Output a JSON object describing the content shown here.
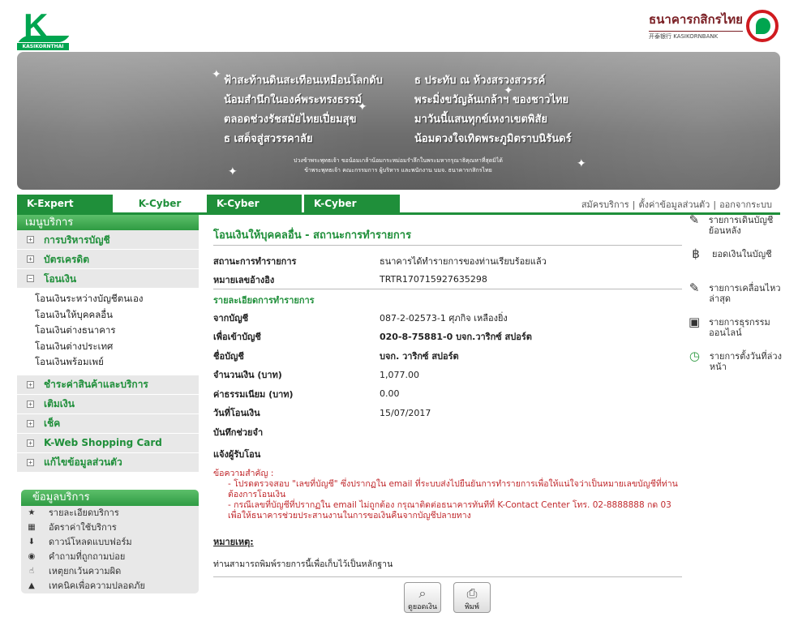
{
  "brand": {
    "logo_text": "KASIKORNTHAI",
    "bank_th": "ธนาคารกสิกรไทย",
    "bank_en": "开泰银行 KASIKORNBANK"
  },
  "banner": {
    "poem_left": [
      "ฟ้าสะท้านดินสะเทือนเหมือนโลกดับ",
      "น้อมสำนึกในองค์พระทรงธรรม์",
      "ตลอดช่วงรัชสมัยไทยเปี่ยมสุข",
      "ธ เสด็จสู่สวรรคาลัย"
    ],
    "poem_right": [
      "ธ ประทับ ณ ห้วงสรวงสวรรค์",
      "พระมิ่งขวัญล้นเกล้าฯ ของชาวไทย",
      "มาวันนี้แสนทุกข์เหงาเขตพิสัย",
      "น้อมดวงใจเทิดพระภูมิตราบนิรันดร์"
    ],
    "dedication": [
      "ปวงข้าพระพุทธเจ้า ขอน้อมเกล้าน้อมกระหม่อมรำลึกในพระมหากรุณาธิคุณหาที่สุดมิได้",
      "ข้าพระพุทธเจ้า คณะกรรมการ ผู้บริหาร และพนักงาน บมจ. ธนาคารกสิกรไทย"
    ]
  },
  "tabs": [
    "K-Expert MyPort",
    "K-Cyber Banking",
    "K-Cyber Invest",
    "K-Cyber Trade"
  ],
  "toplinks": [
    "สมัครบริการ",
    "ตั้งค่าข้อมูลส่วนตัว",
    "ออกจากระบบ"
  ],
  "sidebar": {
    "header": "เมนูบริการ",
    "items": [
      {
        "label": "การบริหารบัญชี",
        "box": "+"
      },
      {
        "label": "บัตรเครดิต",
        "box": "+"
      },
      {
        "label": "โอนเงิน",
        "box": "−"
      }
    ],
    "sub": [
      "โอนเงินระหว่างบัญชีตนเอง",
      "โอนเงินให้บุคคลอื่น",
      "โอนเงินต่างธนาคาร",
      "โอนเงินต่างประเทศ",
      "โอนเงินพร้อมเพย์"
    ],
    "items2": [
      {
        "label": "ชำระค่าสินค้าและบริการ",
        "box": "+"
      },
      {
        "label": "เติมเงิน",
        "box": "+"
      },
      {
        "label": "เช็ค",
        "box": "+"
      },
      {
        "label": "K-Web Shopping Card",
        "box": "+"
      },
      {
        "label": "แก้ไขข้อมูลส่วนตัว",
        "box": "+"
      }
    ]
  },
  "info": {
    "header": "ข้อมูลบริการ",
    "items": [
      {
        "icon": "star-icon",
        "glyph": "★",
        "label": "รายละเอียดบริการ"
      },
      {
        "icon": "calculator-icon",
        "glyph": "▦",
        "label": "อัตราค่าใช้บริการ"
      },
      {
        "icon": "download-icon",
        "glyph": "⬇",
        "label": "ดาวน์โหลดแบบฟอร์ม"
      },
      {
        "icon": "question-icon",
        "glyph": "◉",
        "label": "คำถามที่ถูกถามบ่อย"
      },
      {
        "icon": "hand-icon",
        "glyph": "☝",
        "label": "เหตุยกเว้นความผิด"
      },
      {
        "icon": "lock-icon",
        "glyph": "▲",
        "label": "เทคนิคเพื่อความปลอดภัย"
      }
    ]
  },
  "main": {
    "title": "โอนเงินให้บุคคลอื่น - สถานะการทำรายการ",
    "status_label": "สถานะการทำรายการ",
    "status_value": "ธนาคารได้ทำรายการของท่านเรียบร้อยแล้ว",
    "ref_label": "หมายเลขอ้างอิง",
    "ref_value": "TRTR170715927635298",
    "detail_header": "รายละเอียดการทำรายการ",
    "from_label": "จากบัญชี",
    "from_value": "087-2-02573-1 ศุภกิจ เหลืองยิ่ง",
    "to_label": "เพื่อเข้าบัญชี",
    "to_value": "020-8-75881-0 บจก.วาริกซ์ สปอร์ต",
    "name_label": "ชื่อบัญชี",
    "name_value": "บจก. วาริกซ์ สปอร์ต",
    "amount_label": "จำนวนเงิน (บาท)",
    "amount_value": "1,077.00",
    "fee_label": "ค่าธรรมเนียม (บาท)",
    "fee_value": "0.00",
    "date_label": "วันที่โอนเงิน",
    "date_value": "15/07/2017",
    "memo_label": "บันทึกช่วยจำ",
    "notify_label": "แจ้งผู้รับโอน",
    "warn_head": "ข้อความสำคัญ :",
    "warn1": "- โปรดตรวจสอบ \"เลขที่บัญชี\" ซึ่งปรากฏใน email ที่ระบบส่งไปยืนยันการทำรายการเพื่อให้แน่ใจว่าเป็นหมายเลขบัญชีที่ท่านต้องการโอนเงิน",
    "warn2": "- กรณีเลขที่บัญชีที่ปรากฏใน email ไม่ถูกต้อง กรุณาติดต่อธนาคารทันทีที่ K-Contact Center โทร. 02-8888888 กด 03 เพื่อให้ธนาคารช่วยประสานงานในการขอเงินคืนจากบัญชีปลายทาง",
    "note_head": "หมายเหตุ:",
    "note": "ท่านสามารถพิมพ์รายการนี้เพื่อเก็บไว้เป็นหลักฐาน"
  },
  "buttons": {
    "view": "ดูยอดเงิน",
    "print": "พิมพ์"
  },
  "right": [
    {
      "icon": "statement-icon",
      "glyph": "✎",
      "label": "รายการเดินบัญชีย้อนหลัง"
    },
    {
      "icon": "moneybag-icon",
      "glyph": "฿",
      "label": "ยอดเงินในบัญชี"
    },
    {
      "icon": "recent-icon",
      "glyph": "✎",
      "label": "รายการเคลื่อนไหวล่าสุด"
    },
    {
      "icon": "online-icon",
      "glyph": "▣",
      "label": "รายการธุรกรรมออนไลน์"
    },
    {
      "icon": "clock-icon",
      "glyph": "◷",
      "label": "รายการตั้งวันที่ล่วงหน้า"
    }
  ]
}
